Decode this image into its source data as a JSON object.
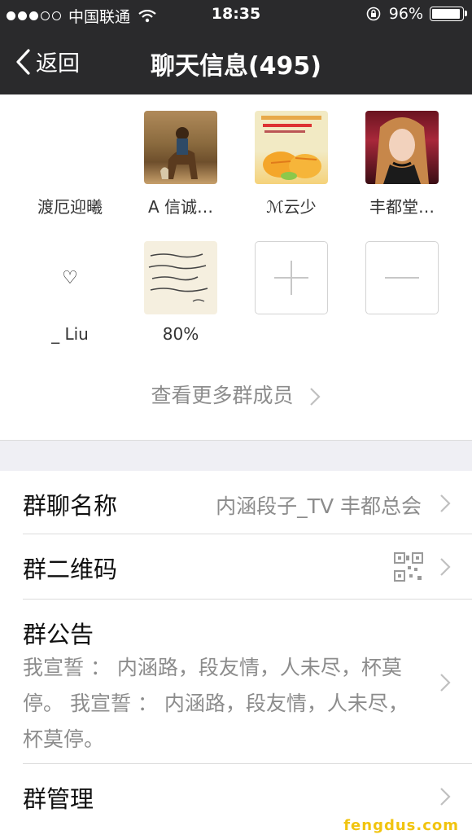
{
  "status_bar": {
    "carrier": "中国联通",
    "time": "18:35",
    "battery_percent": "96%",
    "battery_level": 0.96
  },
  "nav": {
    "back_label": "返回",
    "title": "聊天信息(495)"
  },
  "members": [
    {
      "name": "渡厄迎曦"
    },
    {
      "name": "A 信诚…"
    },
    {
      "name": "ℳ云少"
    },
    {
      "name": "丰都堂…"
    },
    {
      "name": "_ Liu",
      "symbol": "♡"
    },
    {
      "name": "80%"
    }
  ],
  "more_members_label": "查看更多群成员",
  "settings": {
    "group_name_label": "群聊名称",
    "group_name_value": "内涵段子_TV 丰都总会",
    "qr_label": "群二维码",
    "notice_label": "群公告",
    "notice_text": "我宣誓 ： 内涵路，段友情，人未尽，杯莫停。 我宣誓 ： 内涵路，段友情，人未尽，杯莫停。",
    "manage_label": "群管理"
  },
  "watermark": "fengdus.com",
  "colors": {
    "bar_bg": "#2a2a2c",
    "gray_text": "#8c8c8c",
    "divider": "#dcdcdc",
    "section_bg": "#efeff4",
    "watermark": "#f1c40f"
  },
  "icons": [
    "wifi-icon",
    "lock-rotation-icon",
    "battery-icon",
    "back-chevron-icon",
    "plus-icon",
    "minus-icon",
    "chevron-right-icon",
    "qr-code-icon"
  ]
}
